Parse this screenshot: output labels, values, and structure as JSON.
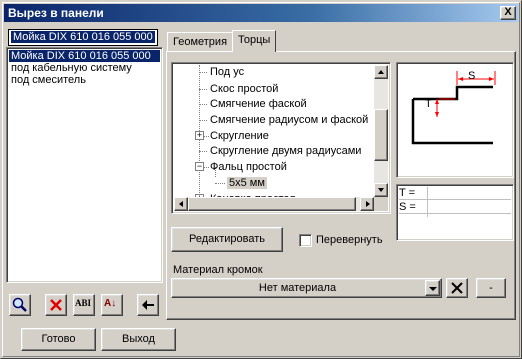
{
  "window": {
    "title": "Вырез в панели",
    "close_label": "X"
  },
  "top_combo": {
    "value": "Мойка DIX 610 016 055 000"
  },
  "cutout_list": [
    {
      "label": "Мойка DIX 610 016 055 000",
      "selected": true
    },
    {
      "label": "под кабельную систему",
      "selected": false
    },
    {
      "label": "под смеситель",
      "selected": false
    }
  ],
  "toolbar": {
    "find_icon": "magnifier-icon",
    "delete_icon": "red-x-icon",
    "rename_label": "ABI",
    "sort_label": "A↓",
    "back_icon": "arrow-left-icon"
  },
  "tabs": [
    {
      "label": "Геометрия",
      "active": false
    },
    {
      "label": "Торцы",
      "active": true
    }
  ],
  "tree": [
    {
      "label": "Под ус",
      "expander": ""
    },
    {
      "label": "Скос простой",
      "expander": ""
    },
    {
      "label": "Смягчение фаской",
      "expander": ""
    },
    {
      "label": "Смягчение радиусом и фаской",
      "expander": ""
    },
    {
      "label": "Скругление",
      "expander": "+"
    },
    {
      "label": "Скругление двумя радиусами",
      "expander": ""
    },
    {
      "label": "Фальц простой",
      "expander": "−"
    },
    {
      "label": "5х5 мм",
      "expander": "",
      "child": true,
      "highlighted": true
    },
    {
      "label": "Канавка простая",
      "expander": "+"
    }
  ],
  "preview": {
    "label_s": "S",
    "label_t": "T",
    "accent": "#ff0000"
  },
  "params": [
    {
      "label": "T =",
      "value": ""
    },
    {
      "label": "S =",
      "value": ""
    }
  ],
  "edit_button": {
    "label": "Редактировать"
  },
  "flip_checkbox": {
    "label": "Перевернуть",
    "checked": false
  },
  "material": {
    "label": "Материал кромок",
    "value": "Нет материала",
    "clear_icon": "x-icon",
    "extra_label": "-"
  },
  "footer": {
    "ok_label": "Готово",
    "exit_label": "Выход"
  }
}
